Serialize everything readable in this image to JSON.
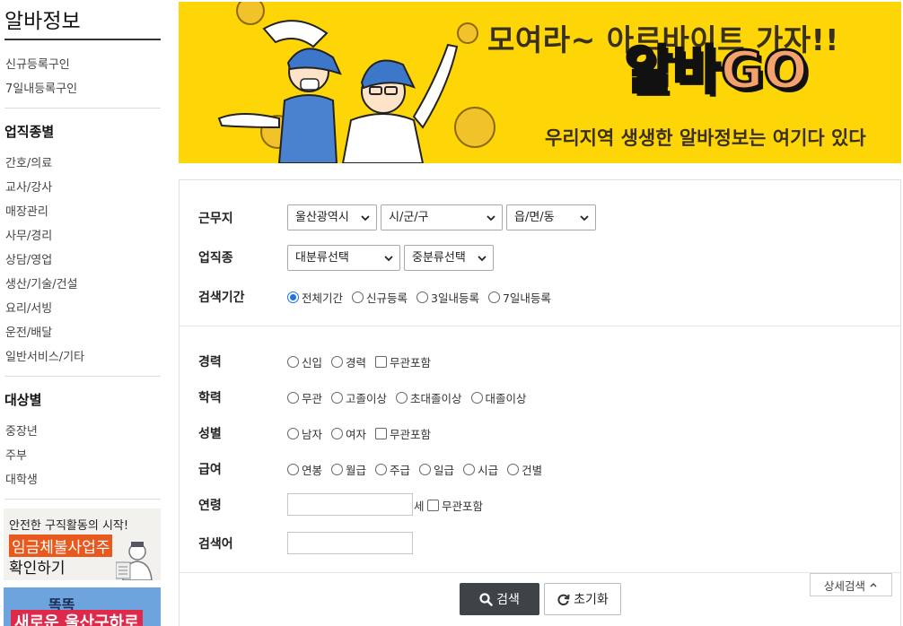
{
  "sidebar": {
    "title": "알바정보",
    "links_top": [
      "신규등록구인",
      "7일내등록구인"
    ],
    "category_heading": "업직종별",
    "categories": [
      "간호/의료",
      "교사/강사",
      "매장관리",
      "사무/경리",
      "상담/영업",
      "생산/기술/건설",
      "요리/서빙",
      "운전/배달",
      "일반서비스/기타"
    ],
    "target_heading": "대상별",
    "targets": [
      "중장년",
      "주부",
      "대학생"
    ],
    "promo1": {
      "line1": "안전한 구직활동의 시작!",
      "line2": "임금체불사업주",
      "line3": "확인하기"
    },
    "promo2": {
      "line1": "똑똑",
      "line2": "새로운 울산구하로"
    }
  },
  "banner": {
    "headline": "모여라~ 아르바이트 가자!!",
    "logo_alba": "알바",
    "logo_go": "GO",
    "subline": "우리지역 생생한 알바정보는 여기다 있다",
    "bg_color": "#fed608"
  },
  "form": {
    "workplace": {
      "label": "근무지",
      "city": "울산광역시",
      "district": "시/군/구",
      "town": "읍/면/동"
    },
    "job": {
      "label": "업직종",
      "major": "대분류선택",
      "minor": "중분류선택"
    },
    "period": {
      "label": "검색기간",
      "options": [
        "전체기간",
        "신규등록",
        "3일내등록",
        "7일내등록"
      ],
      "selected": 0
    },
    "career": {
      "label": "경력",
      "options": [
        "신입",
        "경력"
      ],
      "checkbox": "무관포함"
    },
    "education": {
      "label": "학력",
      "options": [
        "무관",
        "고졸이상",
        "초대졸이상",
        "대졸이상"
      ]
    },
    "gender": {
      "label": "성별",
      "options": [
        "남자",
        "여자"
      ],
      "checkbox": "무관포함"
    },
    "pay": {
      "label": "급여",
      "options": [
        "연봉",
        "월급",
        "주급",
        "일급",
        "시급",
        "건별"
      ]
    },
    "age": {
      "label": "연령",
      "unit": "세",
      "checkbox": "무관포함",
      "value": ""
    },
    "keyword": {
      "label": "검색어",
      "value": ""
    },
    "search_button": "검색",
    "reset_button": "초기화",
    "detail_button": "상세검색"
  },
  "colors": {
    "accent": "#1a73e8",
    "search_button": "#3d4347",
    "promo_orange": "#e8591e"
  }
}
